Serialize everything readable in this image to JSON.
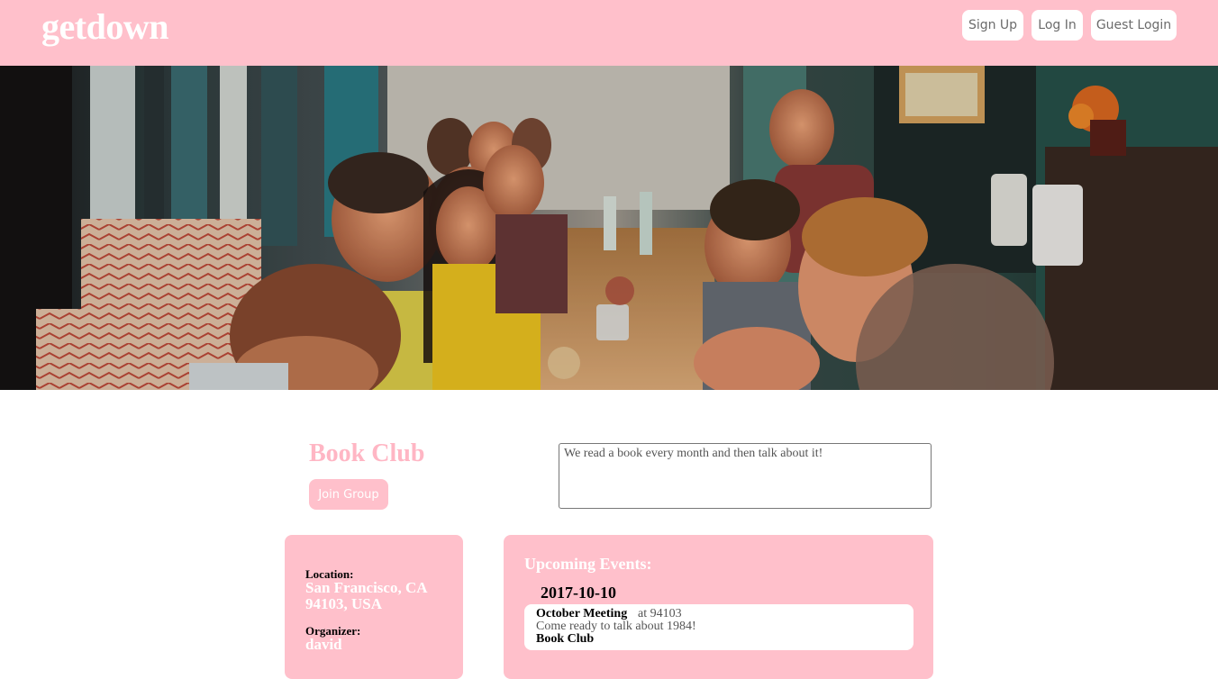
{
  "header": {
    "logo": "getdown",
    "nav": {
      "sign_up": "Sign Up",
      "log_in": "Log In",
      "guest_login": "Guest Login"
    }
  },
  "hero": {
    "description_icon": "restaurant-crowd-photo"
  },
  "group": {
    "title": "Book Club",
    "join_label": "Join Group",
    "description": "We read a book every month and then talk about it!"
  },
  "info": {
    "location_label": "Location:",
    "location_value": "San Francisco, CA 94103, USA",
    "organizer_label": "Organizer:",
    "organizer_value": "david"
  },
  "events": {
    "heading": "Upcoming Events:",
    "days": [
      {
        "date": "2017-10-10",
        "items": [
          {
            "name": "October Meeting",
            "location": "at 94103",
            "description": "Come ready to talk about 1984!",
            "group": "Book Club"
          }
        ]
      }
    ]
  },
  "colors": {
    "brand_pink": "#ffc0cb",
    "title_pink": "#ffb6c4",
    "white": "#ffffff"
  }
}
